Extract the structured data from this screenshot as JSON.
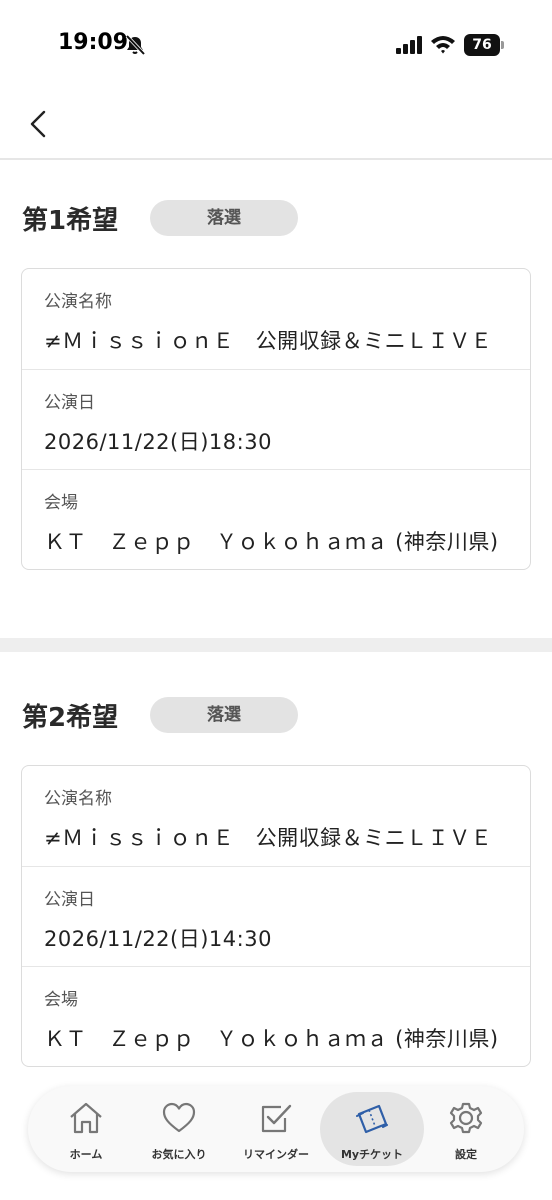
{
  "status_bar": {
    "time": "19:09",
    "battery": "76"
  },
  "sections": [
    {
      "title": "第1希望",
      "badge": "落選",
      "rows": [
        {
          "label": "公演名称",
          "value": "≠ＭｉｓｓｉｏｎＥ　公開収録＆ミニＬＩＶＥ"
        },
        {
          "label": "公演日",
          "value": "2026/11/22(日)18:30"
        },
        {
          "label": "会場",
          "value": "ＫＴ　Ｚｅｐｐ　Ｙｏｋｏｈａｍａ (神奈川県)"
        }
      ]
    },
    {
      "title": "第2希望",
      "badge": "落選",
      "rows": [
        {
          "label": "公演名称",
          "value": "≠ＭｉｓｓｉｏｎＥ　公開収録＆ミニＬＩＶＥ"
        },
        {
          "label": "公演日",
          "value": "2026/11/22(日)14:30"
        },
        {
          "label": "会場",
          "value": "ＫＴ　Ｚｅｐｐ　Ｙｏｋｏｈａｍａ (神奈川県)"
        }
      ]
    }
  ],
  "tabs": [
    {
      "label": "ホーム",
      "icon": "home-icon"
    },
    {
      "label": "お気に入り",
      "icon": "heart-icon"
    },
    {
      "label": "リマインダー",
      "icon": "checkbox-icon"
    },
    {
      "label": "Myチケット",
      "icon": "ticket-icon",
      "active": true
    },
    {
      "label": "設定",
      "icon": "gear-icon"
    }
  ]
}
